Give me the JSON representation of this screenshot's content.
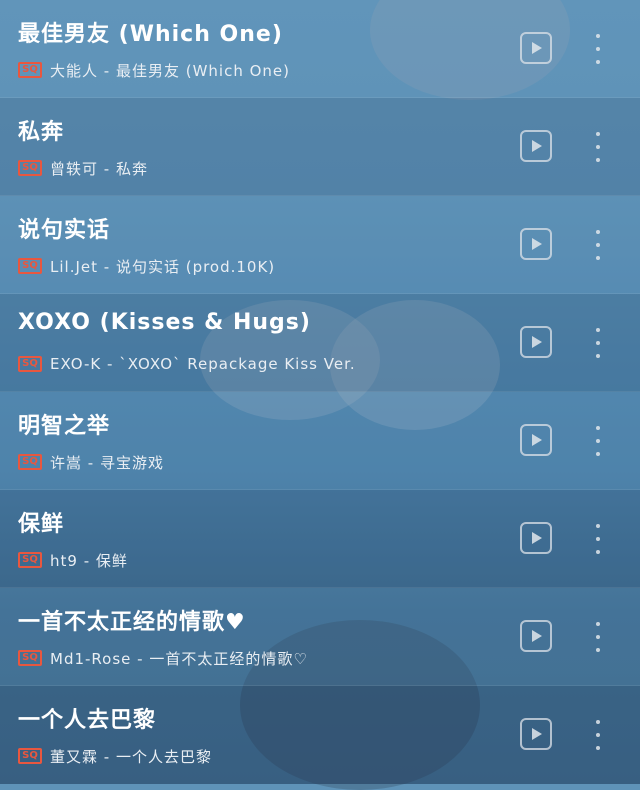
{
  "songs": [
    {
      "title": "最佳男友 (Which One)",
      "badge": "SQ",
      "meta": "大能人 - 最佳男友 (Which One)",
      "play_icon": "play-icon",
      "more_icon": "more-vertical-icon"
    },
    {
      "title": "私奔",
      "badge": "SQ",
      "meta": "曾轶可 - 私奔",
      "play_icon": "play-icon",
      "more_icon": "more-vertical-icon"
    },
    {
      "title": "说句实话",
      "badge": "SQ",
      "meta": "Lil.Jet - 说句实话 (prod.10K)",
      "play_icon": "play-icon",
      "more_icon": "more-vertical-icon"
    },
    {
      "title": "XOXO (Kisses & Hugs)",
      "badge": "SQ",
      "meta": "EXO-K - `XOXO` Repackage Kiss Ver.",
      "play_icon": "play-icon",
      "more_icon": "more-vertical-icon"
    },
    {
      "title": "明智之举",
      "badge": "SQ",
      "meta": "许嵩 - 寻宝游戏",
      "play_icon": "play-icon",
      "more_icon": "more-vertical-icon"
    },
    {
      "title": "保鲜",
      "badge": "SQ",
      "meta": "ht9 - 保鲜",
      "play_icon": "play-icon",
      "more_icon": "more-vertical-icon"
    },
    {
      "title": "一首不太正经的情歌♥",
      "badge": "SQ",
      "meta": "Md1-Rose - 一首不太正经的情歌♡",
      "play_icon": "play-icon",
      "more_icon": "more-vertical-icon"
    },
    {
      "title": "一个人去巴黎",
      "badge": "SQ",
      "meta": "董又霖 - 一个人去巴黎",
      "play_icon": "play-icon",
      "more_icon": "more-vertical-icon"
    }
  ],
  "colors": {
    "badge": "#e8573f",
    "title": "#ffffff",
    "meta": "#e9eef3"
  }
}
